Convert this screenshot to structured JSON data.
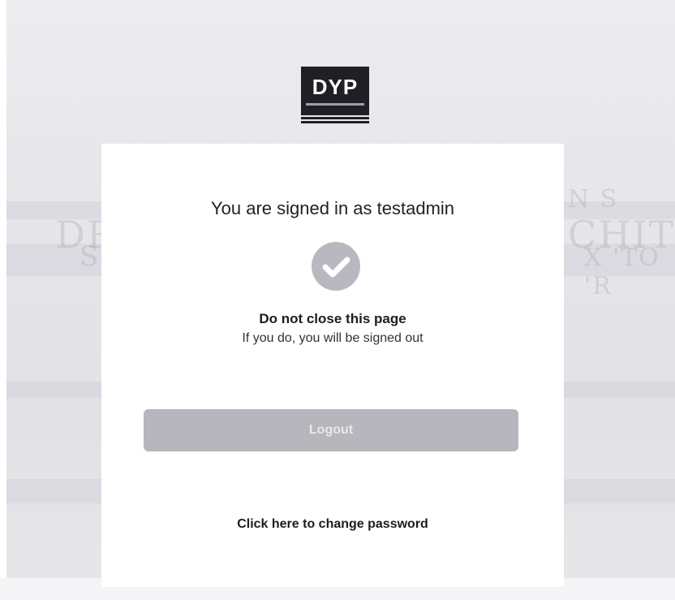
{
  "logo": {
    "text": "DYP"
  },
  "card": {
    "signed_in_text": "You are signed in as testadmin",
    "warning_title": "Do not close this page",
    "warning_subtitle": "If you do, you will be signed out",
    "logout_label": "Logout",
    "change_password_label": "Click here to change password"
  },
  "colors": {
    "button_bg": "#b7b6bc",
    "check_circle": "#b9b8c0",
    "logo_bg": "#1f1f25",
    "card_bg": "#ffffff"
  },
  "icons": {
    "status": "checkmark-circle-icon"
  }
}
